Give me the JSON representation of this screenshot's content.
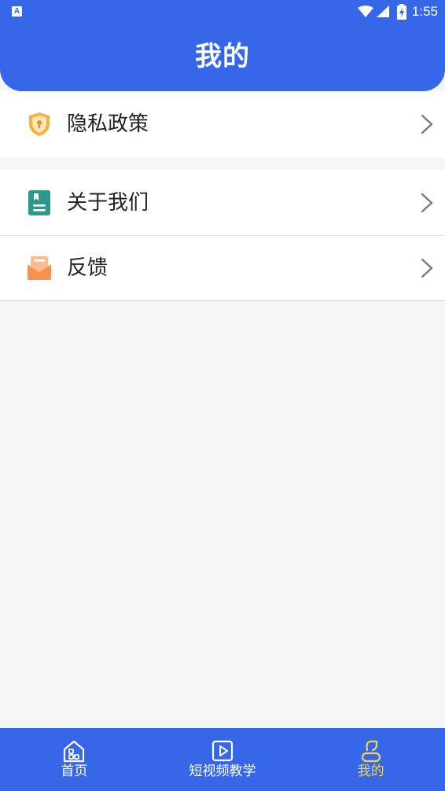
{
  "status_bar": {
    "app_indicator": "A",
    "time": "1:55"
  },
  "header": {
    "title": "我的"
  },
  "menu": {
    "privacy": {
      "label": "隐私政策",
      "icon": "shield-lock-icon"
    },
    "about": {
      "label": "关于我们",
      "icon": "document-icon"
    },
    "feedback": {
      "label": "反馈",
      "icon": "mail-icon"
    }
  },
  "tabs": [
    {
      "label": "首页",
      "icon": "home-icon",
      "active": false
    },
    {
      "label": "短视频教学",
      "icon": "video-play-icon",
      "active": false
    },
    {
      "label": "我的",
      "icon": "person-icon",
      "active": true
    }
  ],
  "colors": {
    "primary": "#3567e8",
    "active_tab": "#f3d54a",
    "background": "#f5f5f5"
  }
}
